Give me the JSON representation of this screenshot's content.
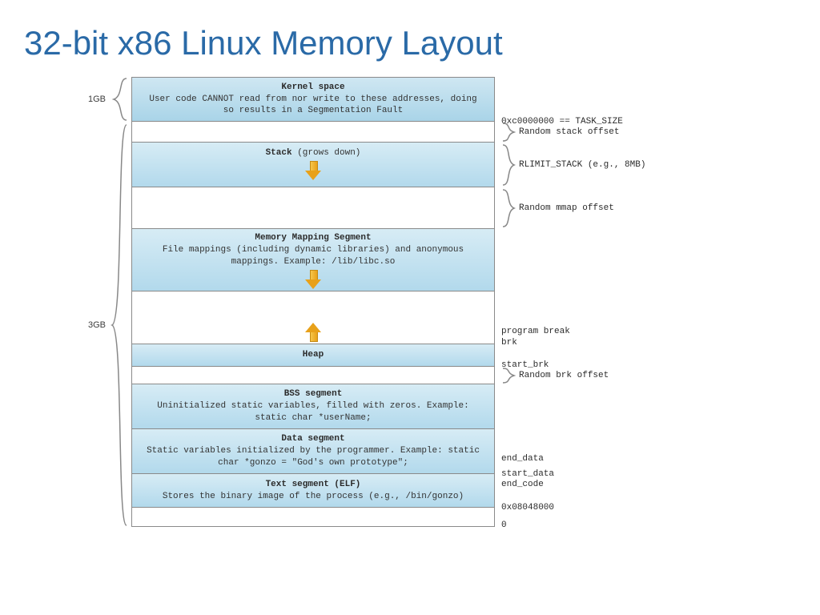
{
  "title": "32-bit x86 Linux Memory Layout",
  "left": {
    "kernel_size": "1GB",
    "user_size": "3GB"
  },
  "segments": {
    "kernel": {
      "title": "Kernel space",
      "desc": "User code CANNOT read from nor write to these addresses, doing so results in a Segmentation Fault"
    },
    "stack": {
      "title": "Stack",
      "suffix": " (grows down)"
    },
    "mmap": {
      "title": "Memory Mapping Segment",
      "desc": "File mappings (including dynamic libraries) and anonymous mappings. Example: /lib/libc.so"
    },
    "heap": {
      "title": "Heap"
    },
    "bss": {
      "title": "BSS segment",
      "desc": "Uninitialized static variables, filled with zeros. Example: static char *userName;"
    },
    "data": {
      "title": "Data segment",
      "desc": "Static variables initialized by the programmer. Example: static char *gonzo = \"God's own prototype\";"
    },
    "text": {
      "title": "Text segment (ELF)",
      "desc": "Stores the binary image of the process (e.g., /bin/gonzo)"
    }
  },
  "right": {
    "task_size": "0xc0000000 == TASK_SIZE",
    "random_stack": "Random stack offset",
    "rlimit_stack": "RLIMIT_STACK (e.g., 8MB)",
    "random_mmap": "Random mmap offset",
    "program_break": "program break",
    "brk": "brk",
    "start_brk": "start_brk",
    "random_brk": "Random brk offset",
    "end_data": "end_data",
    "start_data": "start_data",
    "end_code": "end_code",
    "addr_text": "0x08048000",
    "zero": "0"
  }
}
